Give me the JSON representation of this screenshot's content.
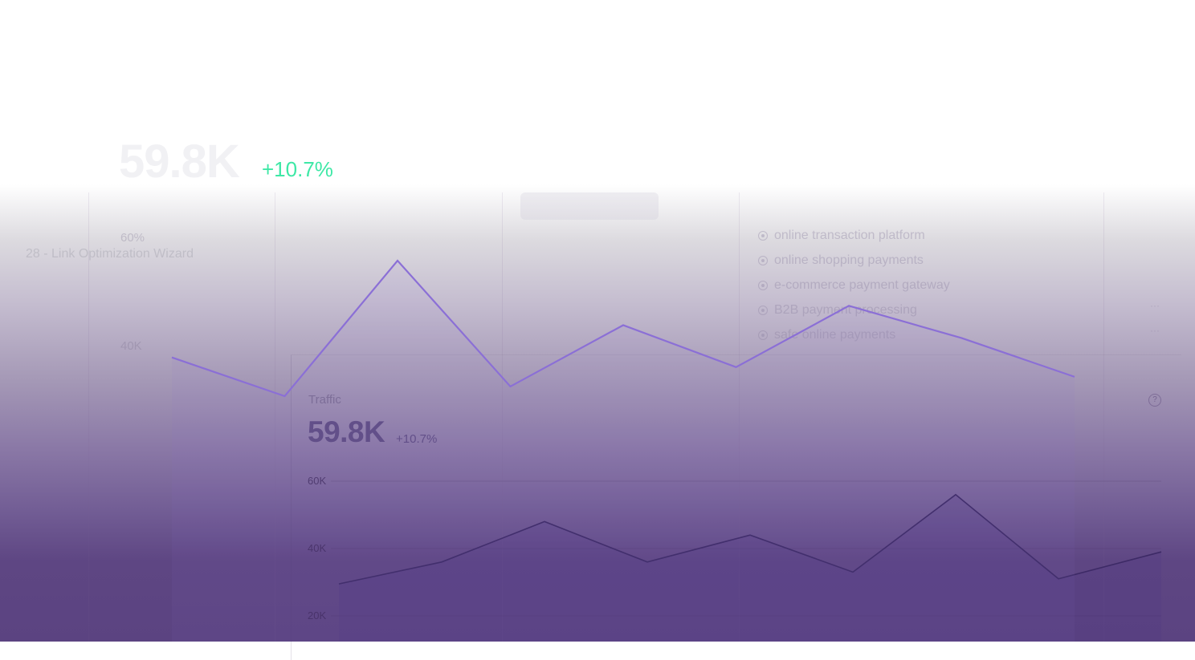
{
  "hero": {
    "value_ghost": "59.8K",
    "delta": "+10.7%",
    "wizard": "28 - Link Optimization Wizard",
    "ghost_pct": "60%",
    "ghost_tick": "40K"
  },
  "keywords": [
    "online transaction platform",
    "online shopping payments",
    "e-commerce payment gateway",
    "B2B payment processing",
    "safe online payments"
  ],
  "card": {
    "label": "Traffic",
    "value": "59.8K",
    "delta": "+10.7%"
  },
  "colors": {
    "accent": "#8b6fd6",
    "delta_green": "#3ee8a6",
    "primary": "#5f4d84",
    "line_dark": "#3d2a66"
  },
  "chart_data": [
    {
      "type": "area",
      "ylim": [
        20000,
        60000
      ],
      "y_ticks": [
        "60K",
        "40K",
        "20K"
      ],
      "series": [
        {
          "values": [
            29500,
            36000,
            48000,
            36000,
            44000,
            33000,
            56000,
            31000,
            39000
          ]
        }
      ]
    },
    {
      "type": "line",
      "series": [
        {
          "values": [
            42,
            30,
            72,
            33,
            52,
            39,
            58,
            48,
            36
          ]
        }
      ]
    }
  ]
}
